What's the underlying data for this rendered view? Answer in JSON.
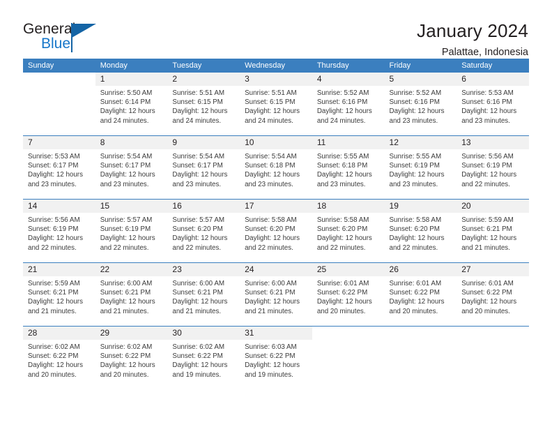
{
  "brand": {
    "name_part1": "General",
    "name_part2": "Blue",
    "mark": "triangle-flag-icon"
  },
  "header": {
    "title": "January 2024",
    "location": "Palattae, Indonesia"
  },
  "calendar": {
    "weekday_headers": [
      "Sunday",
      "Monday",
      "Tuesday",
      "Wednesday",
      "Thursday",
      "Friday",
      "Saturday"
    ],
    "colors": {
      "header_blue": "#3b7fbf",
      "daynum_gray": "#f1f1f1",
      "brand_blue": "#1877c9",
      "text": "#231f20"
    },
    "weeks": [
      [
        {
          "day": "",
          "sunrise": "",
          "sunset": "",
          "daylight_line1": "",
          "daylight_line2": ""
        },
        {
          "day": "1",
          "sunrise": "Sunrise: 5:50 AM",
          "sunset": "Sunset: 6:14 PM",
          "daylight_line1": "Daylight: 12 hours",
          "daylight_line2": "and 24 minutes."
        },
        {
          "day": "2",
          "sunrise": "Sunrise: 5:51 AM",
          "sunset": "Sunset: 6:15 PM",
          "daylight_line1": "Daylight: 12 hours",
          "daylight_line2": "and 24 minutes."
        },
        {
          "day": "3",
          "sunrise": "Sunrise: 5:51 AM",
          "sunset": "Sunset: 6:15 PM",
          "daylight_line1": "Daylight: 12 hours",
          "daylight_line2": "and 24 minutes."
        },
        {
          "day": "4",
          "sunrise": "Sunrise: 5:52 AM",
          "sunset": "Sunset: 6:16 PM",
          "daylight_line1": "Daylight: 12 hours",
          "daylight_line2": "and 24 minutes."
        },
        {
          "day": "5",
          "sunrise": "Sunrise: 5:52 AM",
          "sunset": "Sunset: 6:16 PM",
          "daylight_line1": "Daylight: 12 hours",
          "daylight_line2": "and 23 minutes."
        },
        {
          "day": "6",
          "sunrise": "Sunrise: 5:53 AM",
          "sunset": "Sunset: 6:16 PM",
          "daylight_line1": "Daylight: 12 hours",
          "daylight_line2": "and 23 minutes."
        }
      ],
      [
        {
          "day": "7",
          "sunrise": "Sunrise: 5:53 AM",
          "sunset": "Sunset: 6:17 PM",
          "daylight_line1": "Daylight: 12 hours",
          "daylight_line2": "and 23 minutes."
        },
        {
          "day": "8",
          "sunrise": "Sunrise: 5:54 AM",
          "sunset": "Sunset: 6:17 PM",
          "daylight_line1": "Daylight: 12 hours",
          "daylight_line2": "and 23 minutes."
        },
        {
          "day": "9",
          "sunrise": "Sunrise: 5:54 AM",
          "sunset": "Sunset: 6:17 PM",
          "daylight_line1": "Daylight: 12 hours",
          "daylight_line2": "and 23 minutes."
        },
        {
          "day": "10",
          "sunrise": "Sunrise: 5:54 AM",
          "sunset": "Sunset: 6:18 PM",
          "daylight_line1": "Daylight: 12 hours",
          "daylight_line2": "and 23 minutes."
        },
        {
          "day": "11",
          "sunrise": "Sunrise: 5:55 AM",
          "sunset": "Sunset: 6:18 PM",
          "daylight_line1": "Daylight: 12 hours",
          "daylight_line2": "and 23 minutes."
        },
        {
          "day": "12",
          "sunrise": "Sunrise: 5:55 AM",
          "sunset": "Sunset: 6:19 PM",
          "daylight_line1": "Daylight: 12 hours",
          "daylight_line2": "and 23 minutes."
        },
        {
          "day": "13",
          "sunrise": "Sunrise: 5:56 AM",
          "sunset": "Sunset: 6:19 PM",
          "daylight_line1": "Daylight: 12 hours",
          "daylight_line2": "and 22 minutes."
        }
      ],
      [
        {
          "day": "14",
          "sunrise": "Sunrise: 5:56 AM",
          "sunset": "Sunset: 6:19 PM",
          "daylight_line1": "Daylight: 12 hours",
          "daylight_line2": "and 22 minutes."
        },
        {
          "day": "15",
          "sunrise": "Sunrise: 5:57 AM",
          "sunset": "Sunset: 6:19 PM",
          "daylight_line1": "Daylight: 12 hours",
          "daylight_line2": "and 22 minutes."
        },
        {
          "day": "16",
          "sunrise": "Sunrise: 5:57 AM",
          "sunset": "Sunset: 6:20 PM",
          "daylight_line1": "Daylight: 12 hours",
          "daylight_line2": "and 22 minutes."
        },
        {
          "day": "17",
          "sunrise": "Sunrise: 5:58 AM",
          "sunset": "Sunset: 6:20 PM",
          "daylight_line1": "Daylight: 12 hours",
          "daylight_line2": "and 22 minutes."
        },
        {
          "day": "18",
          "sunrise": "Sunrise: 5:58 AM",
          "sunset": "Sunset: 6:20 PM",
          "daylight_line1": "Daylight: 12 hours",
          "daylight_line2": "and 22 minutes."
        },
        {
          "day": "19",
          "sunrise": "Sunrise: 5:58 AM",
          "sunset": "Sunset: 6:20 PM",
          "daylight_line1": "Daylight: 12 hours",
          "daylight_line2": "and 22 minutes."
        },
        {
          "day": "20",
          "sunrise": "Sunrise: 5:59 AM",
          "sunset": "Sunset: 6:21 PM",
          "daylight_line1": "Daylight: 12 hours",
          "daylight_line2": "and 21 minutes."
        }
      ],
      [
        {
          "day": "21",
          "sunrise": "Sunrise: 5:59 AM",
          "sunset": "Sunset: 6:21 PM",
          "daylight_line1": "Daylight: 12 hours",
          "daylight_line2": "and 21 minutes."
        },
        {
          "day": "22",
          "sunrise": "Sunrise: 6:00 AM",
          "sunset": "Sunset: 6:21 PM",
          "daylight_line1": "Daylight: 12 hours",
          "daylight_line2": "and 21 minutes."
        },
        {
          "day": "23",
          "sunrise": "Sunrise: 6:00 AM",
          "sunset": "Sunset: 6:21 PM",
          "daylight_line1": "Daylight: 12 hours",
          "daylight_line2": "and 21 minutes."
        },
        {
          "day": "24",
          "sunrise": "Sunrise: 6:00 AM",
          "sunset": "Sunset: 6:21 PM",
          "daylight_line1": "Daylight: 12 hours",
          "daylight_line2": "and 21 minutes."
        },
        {
          "day": "25",
          "sunrise": "Sunrise: 6:01 AM",
          "sunset": "Sunset: 6:22 PM",
          "daylight_line1": "Daylight: 12 hours",
          "daylight_line2": "and 20 minutes."
        },
        {
          "day": "26",
          "sunrise": "Sunrise: 6:01 AM",
          "sunset": "Sunset: 6:22 PM",
          "daylight_line1": "Daylight: 12 hours",
          "daylight_line2": "and 20 minutes."
        },
        {
          "day": "27",
          "sunrise": "Sunrise: 6:01 AM",
          "sunset": "Sunset: 6:22 PM",
          "daylight_line1": "Daylight: 12 hours",
          "daylight_line2": "and 20 minutes."
        }
      ],
      [
        {
          "day": "28",
          "sunrise": "Sunrise: 6:02 AM",
          "sunset": "Sunset: 6:22 PM",
          "daylight_line1": "Daylight: 12 hours",
          "daylight_line2": "and 20 minutes."
        },
        {
          "day": "29",
          "sunrise": "Sunrise: 6:02 AM",
          "sunset": "Sunset: 6:22 PM",
          "daylight_line1": "Daylight: 12 hours",
          "daylight_line2": "and 20 minutes."
        },
        {
          "day": "30",
          "sunrise": "Sunrise: 6:02 AM",
          "sunset": "Sunset: 6:22 PM",
          "daylight_line1": "Daylight: 12 hours",
          "daylight_line2": "and 19 minutes."
        },
        {
          "day": "31",
          "sunrise": "Sunrise: 6:03 AM",
          "sunset": "Sunset: 6:22 PM",
          "daylight_line1": "Daylight: 12 hours",
          "daylight_line2": "and 19 minutes."
        },
        {
          "day": "",
          "sunrise": "",
          "sunset": "",
          "daylight_line1": "",
          "daylight_line2": ""
        },
        {
          "day": "",
          "sunrise": "",
          "sunset": "",
          "daylight_line1": "",
          "daylight_line2": ""
        },
        {
          "day": "",
          "sunrise": "",
          "sunset": "",
          "daylight_line1": "",
          "daylight_line2": ""
        }
      ]
    ]
  }
}
